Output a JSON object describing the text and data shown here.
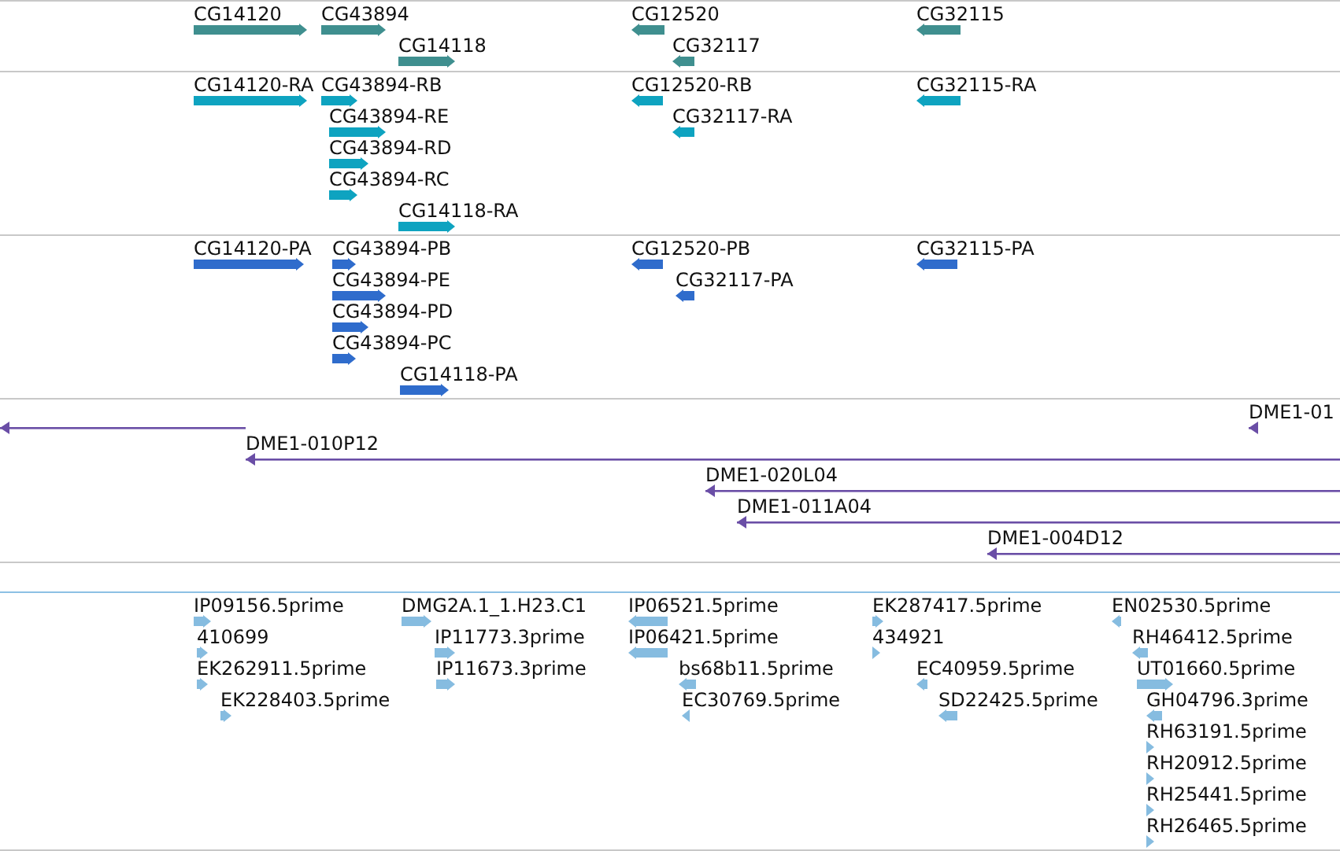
{
  "tracks": [
    {
      "kind": "block",
      "color": "#3f8f8f",
      "features": [
        {
          "label": "CG14120",
          "reverse": false
        },
        {
          "label": "CG43894",
          "reverse": false
        },
        {
          "label": "CG14118",
          "reverse": false
        },
        {
          "label": "CG12520",
          "reverse": true
        },
        {
          "label": "CG32117",
          "reverse": true
        },
        {
          "label": "CG32115",
          "reverse": true
        }
      ]
    },
    {
      "kind": "block",
      "color": "#0ea3c0",
      "features": [
        {
          "label": "CG14120-RA",
          "reverse": false
        },
        {
          "label": "CG43894-RB",
          "reverse": false
        },
        {
          "label": "CG43894-RE",
          "reverse": false
        },
        {
          "label": "CG43894-RD",
          "reverse": false
        },
        {
          "label": "CG43894-RC",
          "reverse": false
        },
        {
          "label": "CG14118-RA",
          "reverse": false
        },
        {
          "label": "CG12520-RB",
          "reverse": true
        },
        {
          "label": "CG32117-RA",
          "reverse": true
        },
        {
          "label": "CG32115-RA",
          "reverse": true
        }
      ]
    },
    {
      "kind": "block",
      "color": "#2f6ccc",
      "features": [
        {
          "label": "CG14120-PA",
          "reverse": false
        },
        {
          "label": "CG43894-PB",
          "reverse": false
        },
        {
          "label": "CG43894-PE",
          "reverse": false
        },
        {
          "label": "CG43894-PD",
          "reverse": false
        },
        {
          "label": "CG43894-PC",
          "reverse": false
        },
        {
          "label": "CG14118-PA",
          "reverse": false
        },
        {
          "label": "CG12520-PB",
          "reverse": true
        },
        {
          "label": "CG32117-PA",
          "reverse": true
        },
        {
          "label": "CG32115-PA",
          "reverse": true
        }
      ]
    },
    {
      "kind": "line",
      "color": "#6a4ea6",
      "features": [
        {
          "reverse": true
        },
        {
          "label": "DME1-01",
          "reverse": true
        },
        {
          "label": "DME1-010P12",
          "reverse": true
        },
        {
          "label": "DME1-020L04",
          "reverse": true
        },
        {
          "label": "DME1-011A04",
          "reverse": true
        },
        {
          "label": "DME1-004D12",
          "reverse": true
        }
      ]
    },
    {
      "kind": "block",
      "color": "#86bce0",
      "features": [
        {
          "label": "IP09156.5prime",
          "reverse": false
        },
        {
          "label": "410699",
          "reverse": false
        },
        {
          "label": "EK262911.5prime",
          "reverse": false
        },
        {
          "label": "EK228403.5prime",
          "reverse": false
        },
        {
          "label": "DMG2A.1_1.H23.C1",
          "reverse": false
        },
        {
          "label": "IP11773.3prime",
          "reverse": false
        },
        {
          "label": "IP11673.3prime",
          "reverse": false
        },
        {
          "label": "IP06521.5prime",
          "reverse": true
        },
        {
          "label": "IP06421.5prime",
          "reverse": true
        },
        {
          "label": "bs68b11.5prime",
          "reverse": true
        },
        {
          "label": "EC30769.5prime",
          "reverse": true
        },
        {
          "label": "EK287417.5prime",
          "reverse": false
        },
        {
          "label": "434921",
          "reverse": false
        },
        {
          "label": "EC40959.5prime",
          "reverse": true
        },
        {
          "label": "SD22425.5prime",
          "reverse": true
        },
        {
          "label": "EN02530.5prime",
          "reverse": true
        },
        {
          "label": "RH46412.5prime",
          "reverse": true
        },
        {
          "label": "UT01660.5prime",
          "reverse": false
        },
        {
          "label": "GH04796.3prime",
          "reverse": true
        },
        {
          "label": "RH63191.5prime",
          "reverse": false
        },
        {
          "label": "RH20912.5prime",
          "reverse": false
        },
        {
          "label": "RH25441.5prime",
          "reverse": false
        },
        {
          "label": "RH26465.5prime",
          "reverse": false
        }
      ]
    }
  ]
}
